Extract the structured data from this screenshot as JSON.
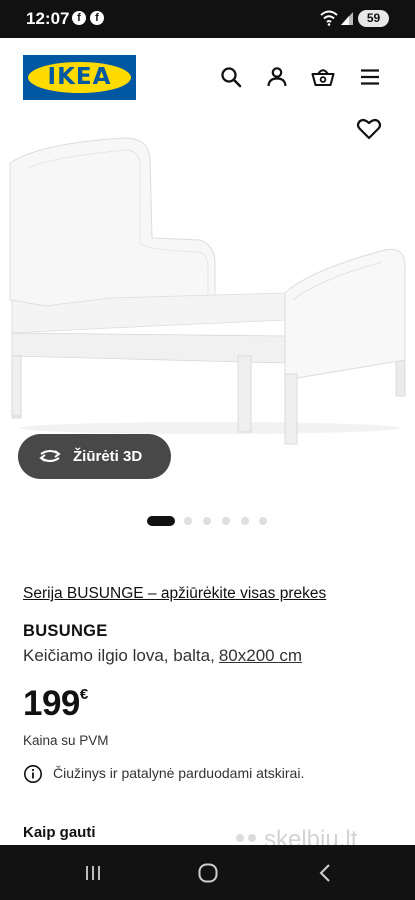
{
  "status_bar": {
    "time": "12:07",
    "notification_icons": [
      "facebook-icon",
      "facebook-icon"
    ],
    "system_icons": [
      "wifi-icon",
      "signal-icon"
    ],
    "battery_level": "59"
  },
  "header": {
    "logo_text": "IKEA",
    "brand_colors": {
      "blue": "#0058a3",
      "yellow": "#ffdb00"
    },
    "icons": [
      "search-icon",
      "profile-icon",
      "basket-icon",
      "menu-icon"
    ]
  },
  "gallery": {
    "favorite_icon": "heart-icon",
    "view_3d_label": "Žiūrėti 3D",
    "carousel_dot_count": 6,
    "active_dot_index": 0
  },
  "product": {
    "series_link": "Serija BUSUNGE – apžiūrėkite visas prekes",
    "name": "BUSUNGE",
    "description": "Keičiamo ilgio lova, balta,",
    "size_link": "80x200 cm",
    "price": "199",
    "currency": "€",
    "vat_note": "Kaina su PVM",
    "info_notice": "Čiužinys ir patalynė parduodami atskirai.",
    "how_to_get": "Kaip gauti"
  },
  "watermark": {
    "text": "skelbiu.lt"
  },
  "navigation_bar": {
    "icons": [
      "recent-apps-icon",
      "home-icon",
      "back-icon"
    ]
  }
}
